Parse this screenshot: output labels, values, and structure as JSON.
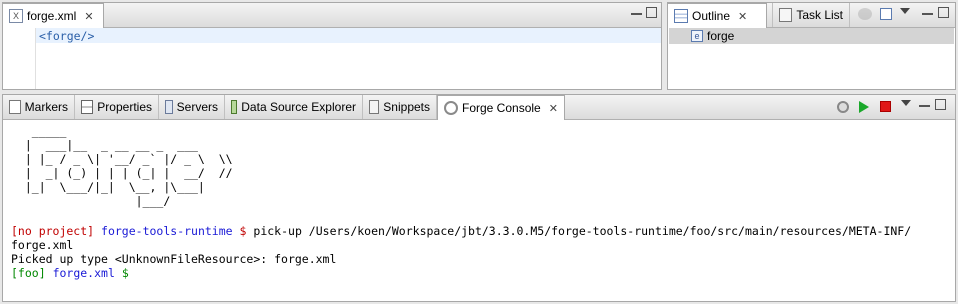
{
  "editor": {
    "tab_label": "forge.xml",
    "tab_icon": "xml-file-icon",
    "code_line": "<forge/>"
  },
  "outline": {
    "tabs": [
      {
        "label": "Outline",
        "icon": "outline-icon"
      },
      {
        "label": "Task List",
        "icon": "task-list-icon"
      }
    ],
    "tree_item": "forge"
  },
  "bottom": {
    "tabs": [
      {
        "label": "Markers",
        "icon": "markers-icon"
      },
      {
        "label": "Properties",
        "icon": "properties-icon"
      },
      {
        "label": "Servers",
        "icon": "servers-icon"
      },
      {
        "label": "Data Source Explorer",
        "icon": "data-source-icon"
      },
      {
        "label": "Snippets",
        "icon": "snippets-icon"
      },
      {
        "label": "Forge Console",
        "icon": "forge-console-icon"
      }
    ]
  },
  "console": {
    "ascii_art": [
      "   _____",
      "  |  ___|__  _ __ __ _  ___",
      "  | |_ / _ \\| '__/ _` |/ _ \\  \\\\",
      "  |  _| (_) | | | (_| |  __/  //",
      "  |_|  \\___/|_|  \\__, |\\___|",
      "                  |___/"
    ],
    "prompt1_project": "[no project]",
    "prompt1_runtime": "forge-tools-runtime",
    "prompt1_dollar": "$",
    "prompt1_command": "pick-up /Users/koen/Workspace/jbt/3.3.0.M5/forge-tools-runtime/foo/src/main/resources/META-INF/",
    "prompt1_command_cont": "forge.xml",
    "output_line": "Picked up type <UnknownFileResource>: forge.xml",
    "prompt2_project": "[foo]",
    "prompt2_file": "forge.xml",
    "prompt2_dollar": "$"
  },
  "colors": {
    "prompt_red": "#c00000",
    "prompt_blue": "#1a1ad6",
    "prompt_green": "#008800",
    "code_tag": "#2a5fa8"
  }
}
